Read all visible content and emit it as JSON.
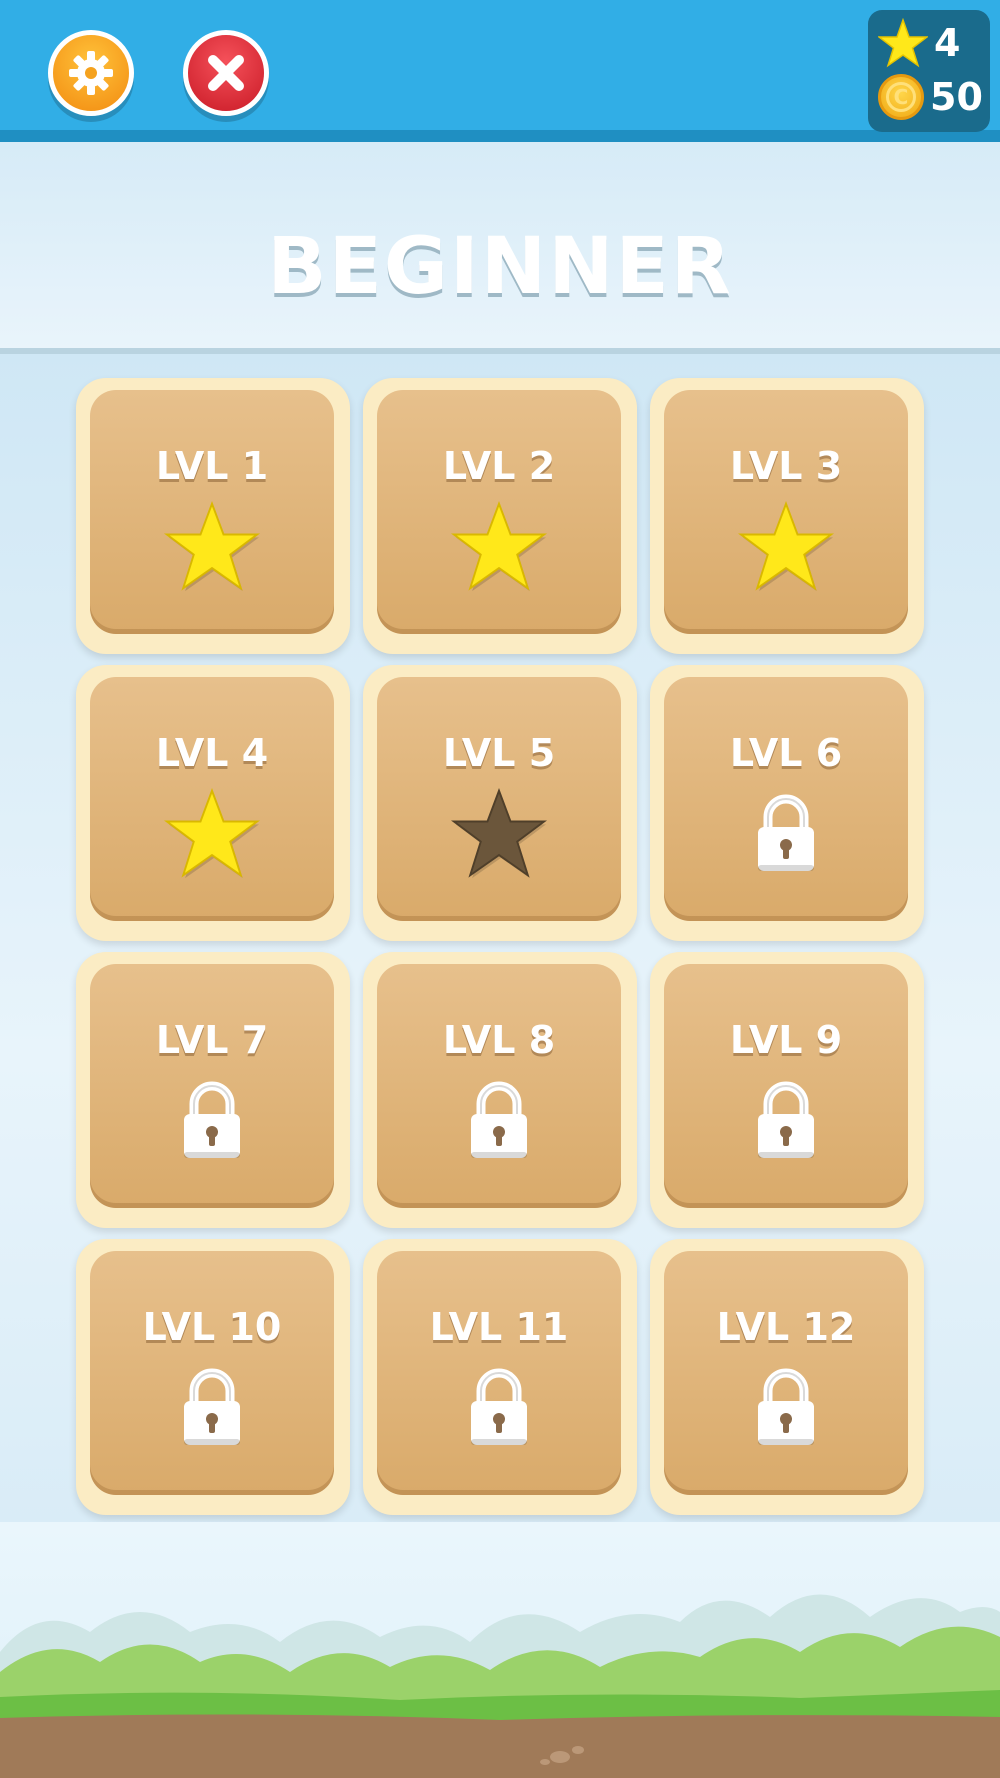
{
  "header": {
    "stars_count": "4",
    "coins_count": "50"
  },
  "title": "BEGINNER",
  "levels": [
    {
      "label": "LVL 1",
      "state": "star-earned"
    },
    {
      "label": "LVL 2",
      "state": "star-earned"
    },
    {
      "label": "LVL 3",
      "state": "star-earned"
    },
    {
      "label": "LVL 4",
      "state": "star-earned"
    },
    {
      "label": "LVL 5",
      "state": "star-empty"
    },
    {
      "label": "LVL 6",
      "state": "locked"
    },
    {
      "label": "LVL 7",
      "state": "locked"
    },
    {
      "label": "LVL 8",
      "state": "locked"
    },
    {
      "label": "LVL 9",
      "state": "locked"
    },
    {
      "label": "LVL 10",
      "state": "locked"
    },
    {
      "label": "LVL 11",
      "state": "locked"
    },
    {
      "label": "LVL 12",
      "state": "locked"
    }
  ],
  "colors": {
    "topbar": "#31aee6",
    "star_earned": "#ffe81a",
    "star_empty": "#6b563b",
    "tile": "#e0b57b"
  },
  "icons": {
    "settings": "gear-icon",
    "close": "close-icon",
    "star": "star-icon",
    "coin": "coin-icon",
    "lock": "lock-icon"
  }
}
